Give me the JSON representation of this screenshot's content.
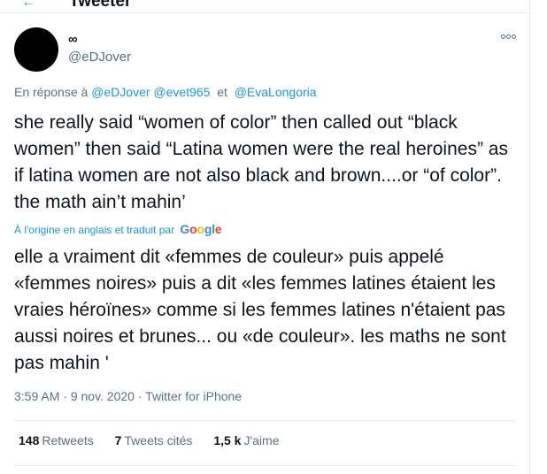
{
  "header": {
    "back_icon": "arrow-left-icon",
    "title": "Tweeter"
  },
  "author": {
    "name": "∞",
    "handle": "@eDJover"
  },
  "reply": {
    "prefix": "En réponse à",
    "mention1": "@eDJover",
    "mention2": "@evet965",
    "and": "et",
    "mention3": "@EvaLongoria"
  },
  "tweet": {
    "text": "she really said “women of color” then called out “black women” then said “Latina women were the real heroines” as if latina women are not also black and brown....or “of color”. the math ain’t mahin’"
  },
  "translation": {
    "label": "À l'origine en anglais et traduit par",
    "provider": "Google",
    "text": "elle a vraiment dit «femmes de couleur» puis appelé «femmes noires» puis a dit «les femmes latines étaient les vraies héroïnes» comme si les femmes latines n'étaient pas aussi noires et brunes... ou «de couleur». les maths ne sont pas mahin '"
  },
  "meta": {
    "time": "3:59 AM",
    "date": "9 nov. 2020",
    "dot": "·",
    "source": "Twitter for iPhone"
  },
  "stats": {
    "retweets_count": "148",
    "retweets_label": "Retweets",
    "quotes_count": "7",
    "quotes_label": "Tweets cités",
    "likes_count": "1,5 k",
    "likes_label": "J'aime"
  },
  "colors": {
    "link": "#1b95e0",
    "muted": "#5b7083",
    "text": "#0f1419",
    "border": "#e6ecf0"
  }
}
